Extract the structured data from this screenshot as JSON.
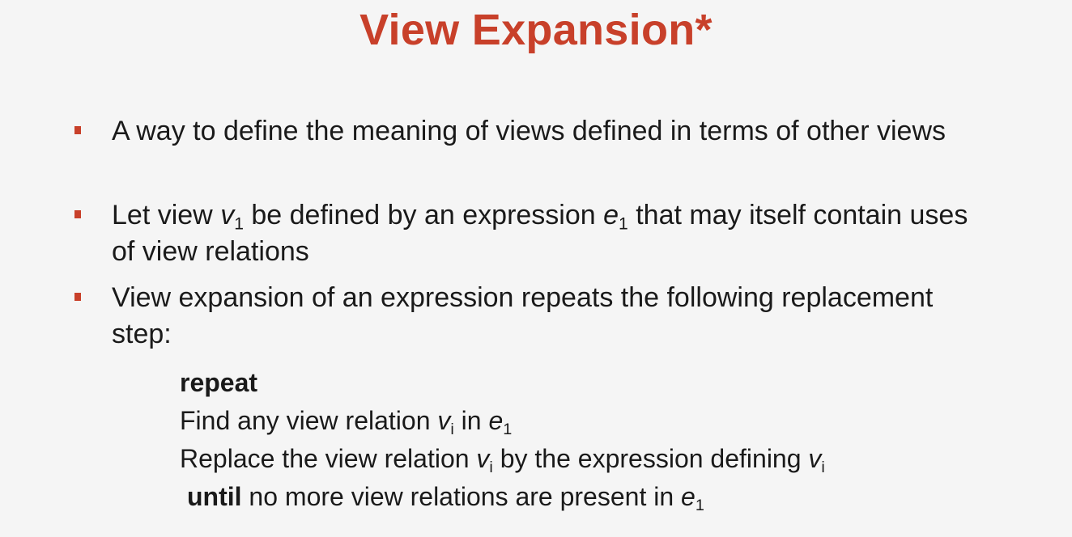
{
  "slide": {
    "title": "View Expansion*",
    "bullets": [
      {
        "text": "A way to define the meaning of views defined in terms of other views"
      },
      {
        "pre": "Let view ",
        "var1": "v",
        "sub1": "1",
        "mid": " be defined by an expression ",
        "var2": "e",
        "sub2": "1",
        "post": " that may itself contain uses of view relations"
      },
      {
        "text": "View expansion of an expression repeats the following replacement step:"
      }
    ],
    "algorithm": {
      "repeat_kw": "repeat",
      "line1": {
        "pre": "Find any view relation ",
        "var1": "v",
        "sub1": "i",
        "mid": " in ",
        "var2": "e",
        "sub2": "1"
      },
      "line2": {
        "pre": "Replace the view relation ",
        "var1": "v",
        "sub1": "i",
        "mid": " by the expression defining ",
        "var2": "v",
        "sub2": "i"
      },
      "line3": {
        "until_kw": "until",
        "mid": " no more view relations are present in ",
        "var1": "e",
        "sub1": "1"
      }
    },
    "colors": {
      "accent": "#c8402a",
      "text": "#1a1a1a",
      "background": "#f5f5f5"
    }
  }
}
